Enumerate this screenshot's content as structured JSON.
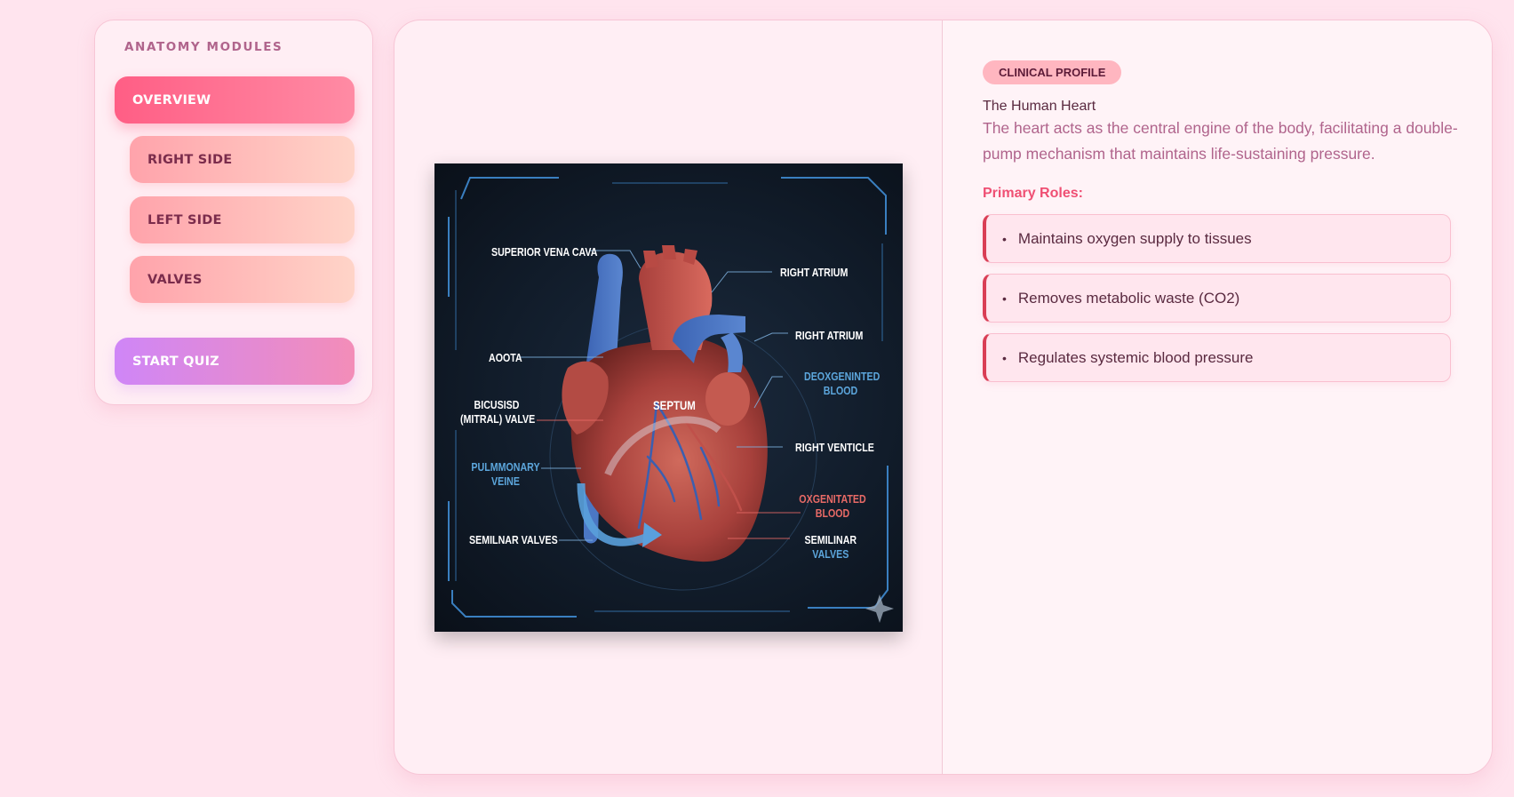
{
  "sidebar": {
    "heading": "ANATOMY MODULES",
    "items": [
      {
        "label": "OVERVIEW",
        "active": true
      },
      {
        "label": "RIGHT SIDE"
      },
      {
        "label": "LEFT SIDE"
      },
      {
        "label": "VALVES"
      }
    ],
    "quiz_label": "START QUIZ"
  },
  "figure": {
    "labels": {
      "superior_vena_cava": "SUPERIOR VENA CAVA",
      "right_atrium_top": "RIGHT ATRIUM",
      "right_atrium_mid": "RIGHT ATRIUM",
      "aorta": "AOOTA",
      "deoxygenated_1": "DEOXGENINTED",
      "deoxygenated_2": "BLOOD",
      "bicuspid_1": "BICUSISD",
      "bicuspid_2": "(MITRAL) VALVE",
      "septum": "SEPTUM",
      "right_ventricle": "RIGHT VENTICLE",
      "pulmonary_1": "PULMMONARY",
      "pulmonary_2": "VEINE",
      "oxygenated_1": "OXGENITATED",
      "oxygenated_2": "BLOOD",
      "semilunar_left": "SEMILNAR VALVES",
      "semilunar_right_1": "SEMILINAR",
      "semilunar_right_2": "VALVES"
    }
  },
  "profile": {
    "badge": "CLINICAL PROFILE",
    "subtitle": "The Human Heart",
    "description": "The heart acts as the central engine of the body, facilitating a double-pump mechanism that maintains life-sustaining pressure.",
    "roles_title": "Primary Roles:",
    "roles": [
      "Maintains oxygen supply to tissues",
      "Removes metabolic waste (CO2)",
      "Regulates systemic blood pressure"
    ],
    "bullet": "•"
  },
  "colors": {
    "accent": "#ff5e85",
    "role_border": "#d93e55",
    "background": "#ffe4ee"
  }
}
